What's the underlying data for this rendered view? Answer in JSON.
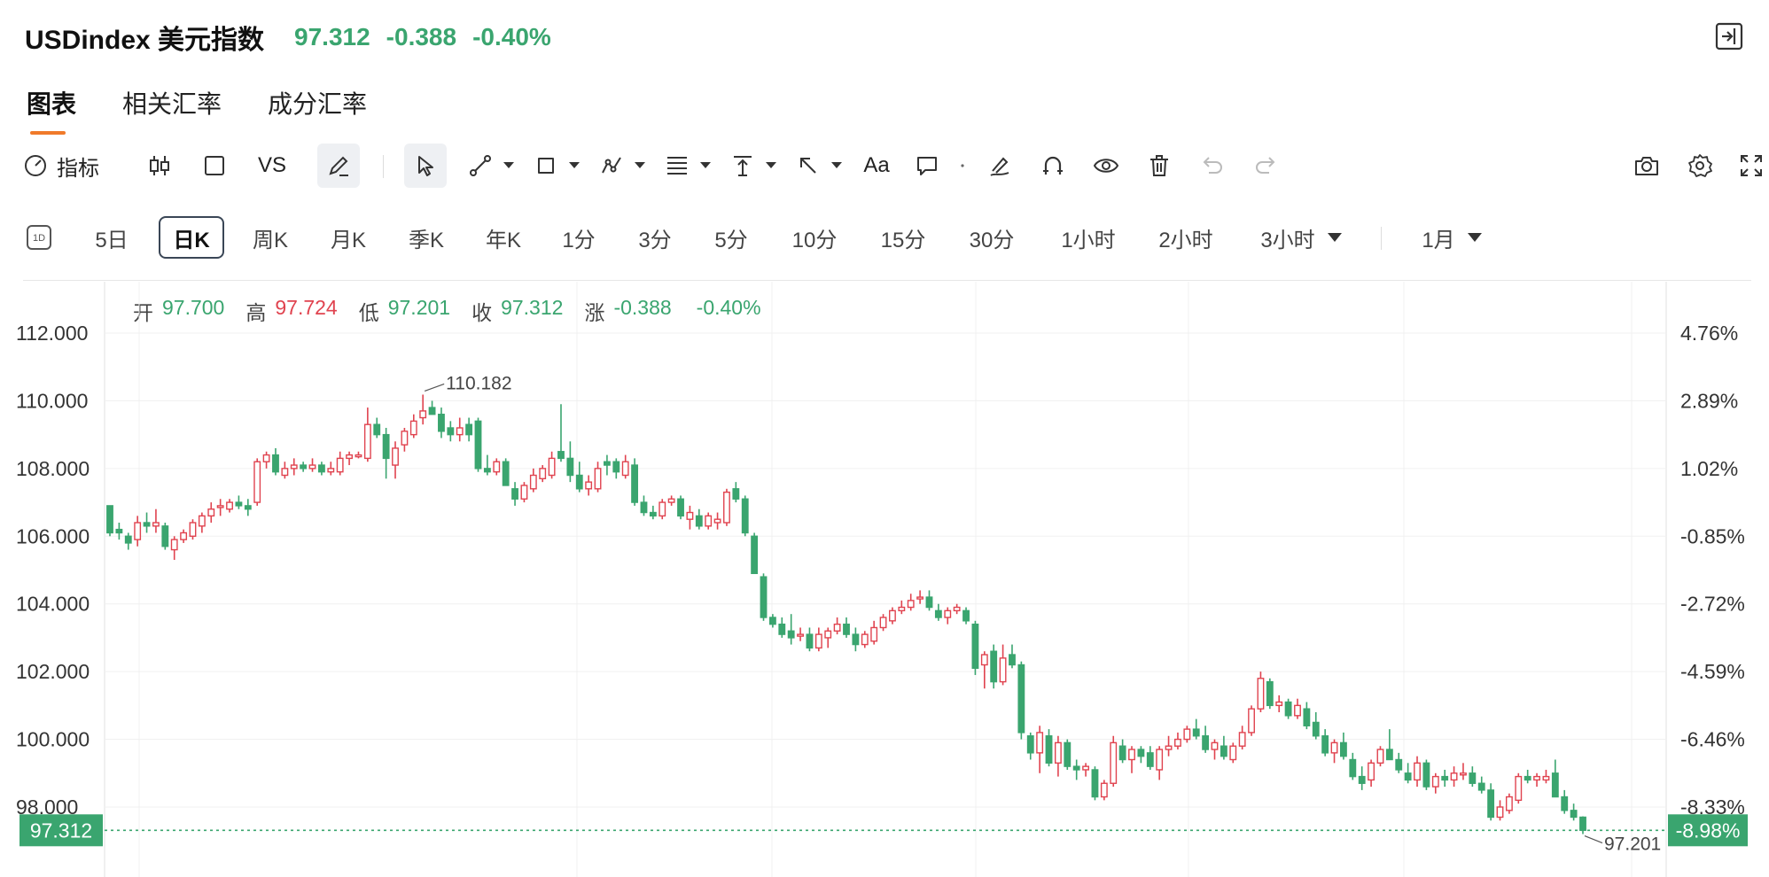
{
  "header": {
    "symbol": "USDindex 美元指数",
    "price": "97.312",
    "change": "-0.388",
    "change_pct": "-0.40%"
  },
  "tabs": [
    "图表",
    "相关汇率",
    "成分汇率"
  ],
  "toolbar": {
    "indicator_label": "指标",
    "vs_label": "VS",
    "text_label": "Aa"
  },
  "periods": [
    "5日",
    "日K",
    "周K",
    "月K",
    "季K",
    "年K",
    "1分",
    "3分",
    "5分",
    "10分",
    "15分",
    "30分",
    "1小时",
    "2小时",
    "3小时",
    "1月"
  ],
  "ohlc": {
    "open_label": "开",
    "open": "97.700",
    "high_label": "高",
    "high": "97.724",
    "low_label": "低",
    "low": "97.201",
    "close_label": "收",
    "close": "97.312",
    "chg_label": "涨",
    "chg": "-0.388",
    "chg_pct": "-0.40%"
  },
  "colors": {
    "up": "#e0434f",
    "down": "#3aa56f",
    "accent": "#f07a2a"
  },
  "chart_data": {
    "type": "candlestick",
    "y_ticks": [
      "112.000",
      "110.000",
      "108.000",
      "106.000",
      "104.000",
      "102.000",
      "100.000",
      "98.000"
    ],
    "y_pct_ticks": [
      "4.76%",
      "2.89%",
      "1.02%",
      "-0.85%",
      "-2.72%",
      "-4.59%",
      "-6.46%",
      "-8.33%"
    ],
    "ylim": [
      97.0,
      112.0
    ],
    "last_price": "97.312",
    "last_pct": "-8.98%",
    "max_label": "110.182",
    "min_label": "97.201",
    "candles": [
      [
        106.9,
        106.9,
        106.0,
        106.1
      ],
      [
        106.2,
        106.4,
        105.9,
        106.1
      ],
      [
        106.0,
        106.1,
        105.6,
        105.8
      ],
      [
        105.9,
        106.6,
        105.7,
        106.4
      ],
      [
        106.4,
        106.7,
        106.1,
        106.3
      ],
      [
        106.3,
        106.8,
        106.1,
        106.4
      ],
      [
        106.3,
        106.4,
        105.6,
        105.7
      ],
      [
        105.6,
        106.0,
        105.3,
        105.9
      ],
      [
        105.9,
        106.2,
        105.8,
        106.1
      ],
      [
        106.0,
        106.5,
        105.9,
        106.4
      ],
      [
        106.3,
        106.7,
        106.1,
        106.6
      ],
      [
        106.6,
        107.0,
        106.4,
        106.8
      ],
      [
        106.9,
        107.1,
        106.6,
        106.9
      ],
      [
        106.8,
        107.1,
        106.7,
        107.0
      ],
      [
        107.0,
        107.2,
        106.8,
        106.9
      ],
      [
        106.9,
        107.1,
        106.6,
        106.8
      ],
      [
        107.0,
        108.3,
        106.9,
        108.2
      ],
      [
        108.2,
        108.5,
        108.0,
        108.4
      ],
      [
        108.4,
        108.6,
        107.8,
        107.9
      ],
      [
        107.8,
        108.2,
        107.7,
        108.0
      ],
      [
        108.0,
        108.3,
        107.8,
        108.1
      ],
      [
        108.1,
        108.2,
        107.9,
        108.0
      ],
      [
        108.0,
        108.3,
        107.9,
        108.1
      ],
      [
        108.1,
        108.2,
        107.8,
        107.9
      ],
      [
        107.9,
        108.2,
        107.8,
        108.0
      ],
      [
        107.9,
        108.5,
        107.8,
        108.3
      ],
      [
        108.3,
        108.5,
        108.1,
        108.4
      ],
      [
        108.4,
        108.5,
        108.3,
        108.4
      ],
      [
        108.3,
        109.8,
        108.2,
        109.3
      ],
      [
        109.3,
        109.5,
        108.9,
        109.0
      ],
      [
        109.0,
        109.2,
        107.7,
        108.3
      ],
      [
        108.1,
        108.8,
        107.7,
        108.6
      ],
      [
        108.7,
        109.2,
        108.5,
        109.1
      ],
      [
        109.0,
        109.6,
        108.9,
        109.4
      ],
      [
        109.5,
        110.182,
        109.3,
        109.7
      ],
      [
        109.8,
        110.0,
        109.6,
        109.6
      ],
      [
        109.6,
        109.8,
        108.9,
        109.1
      ],
      [
        109.2,
        109.4,
        108.8,
        109.0
      ],
      [
        109.0,
        109.5,
        108.8,
        109.2
      ],
      [
        109.3,
        109.5,
        108.8,
        109.0
      ],
      [
        109.4,
        109.5,
        107.9,
        108.0
      ],
      [
        108.0,
        108.4,
        107.8,
        107.9
      ],
      [
        107.9,
        108.3,
        107.8,
        108.2
      ],
      [
        108.2,
        108.3,
        107.5,
        107.5
      ],
      [
        107.4,
        107.6,
        106.9,
        107.1
      ],
      [
        107.1,
        107.6,
        107.0,
        107.5
      ],
      [
        107.4,
        108.0,
        107.3,
        107.8
      ],
      [
        107.7,
        108.1,
        107.6,
        108.0
      ],
      [
        107.8,
        108.5,
        107.7,
        108.3
      ],
      [
        108.5,
        109.9,
        108.2,
        108.3
      ],
      [
        108.3,
        108.8,
        107.6,
        107.8
      ],
      [
        107.8,
        108.2,
        107.3,
        107.4
      ],
      [
        107.4,
        107.8,
        107.2,
        107.6
      ],
      [
        107.4,
        108.2,
        107.3,
        108.0
      ],
      [
        108.2,
        108.4,
        107.8,
        108.1
      ],
      [
        108.2,
        108.3,
        107.7,
        107.9
      ],
      [
        107.8,
        108.4,
        107.7,
        108.2
      ],
      [
        108.1,
        108.3,
        106.9,
        107.0
      ],
      [
        107.0,
        107.2,
        106.6,
        106.7
      ],
      [
        106.7,
        106.9,
        106.5,
        106.6
      ],
      [
        106.6,
        107.1,
        106.5,
        107.0
      ],
      [
        107.0,
        107.2,
        106.9,
        107.1
      ],
      [
        107.1,
        107.2,
        106.5,
        106.6
      ],
      [
        106.5,
        106.9,
        106.2,
        106.7
      ],
      [
        106.6,
        106.8,
        106.2,
        106.3
      ],
      [
        106.3,
        106.7,
        106.2,
        106.6
      ],
      [
        106.4,
        106.7,
        106.2,
        106.5
      ],
      [
        106.4,
        107.4,
        106.3,
        107.3
      ],
      [
        107.4,
        107.6,
        107.0,
        107.1
      ],
      [
        107.1,
        107.2,
        106.0,
        106.1
      ],
      [
        106.0,
        106.1,
        104.9,
        104.9
      ],
      [
        104.8,
        104.9,
        103.5,
        103.6
      ],
      [
        103.6,
        103.7,
        103.3,
        103.4
      ],
      [
        103.4,
        103.6,
        103.0,
        103.1
      ],
      [
        103.2,
        103.7,
        102.8,
        103.0
      ],
      [
        103.1,
        103.3,
        102.9,
        103.1
      ],
      [
        103.1,
        103.3,
        102.6,
        102.7
      ],
      [
        102.7,
        103.3,
        102.6,
        103.1
      ],
      [
        103.0,
        103.3,
        102.7,
        103.2
      ],
      [
        103.2,
        103.6,
        103.1,
        103.4
      ],
      [
        103.4,
        103.6,
        103.0,
        103.1
      ],
      [
        103.1,
        103.3,
        102.6,
        102.8
      ],
      [
        102.8,
        103.2,
        102.7,
        103.1
      ],
      [
        102.9,
        103.5,
        102.8,
        103.3
      ],
      [
        103.3,
        103.7,
        103.2,
        103.6
      ],
      [
        103.5,
        103.9,
        103.4,
        103.8
      ],
      [
        103.8,
        104.1,
        103.7,
        103.9
      ],
      [
        103.9,
        104.3,
        103.8,
        104.1
      ],
      [
        104.2,
        104.4,
        104.0,
        104.2
      ],
      [
        104.2,
        104.4,
        103.8,
        103.9
      ],
      [
        103.8,
        104.0,
        103.5,
        103.6
      ],
      [
        103.6,
        103.9,
        103.4,
        103.8
      ],
      [
        103.8,
        104.0,
        103.7,
        103.9
      ],
      [
        103.8,
        103.9,
        103.4,
        103.5
      ],
      [
        103.4,
        103.5,
        101.9,
        102.1
      ],
      [
        102.2,
        102.6,
        101.5,
        102.5
      ],
      [
        102.6,
        102.8,
        101.5,
        101.7
      ],
      [
        101.7,
        102.8,
        101.6,
        102.4
      ],
      [
        102.5,
        102.8,
        102.1,
        102.2
      ],
      [
        102.2,
        102.3,
        100.0,
        100.2
      ],
      [
        100.1,
        100.2,
        99.4,
        99.6
      ],
      [
        99.6,
        100.4,
        99.0,
        100.2
      ],
      [
        100.1,
        100.3,
        99.2,
        99.3
      ],
      [
        99.3,
        100.1,
        98.9,
        99.9
      ],
      [
        99.9,
        100.0,
        99.1,
        99.2
      ],
      [
        99.2,
        99.4,
        98.8,
        99.1
      ],
      [
        99.1,
        99.3,
        98.9,
        99.2
      ],
      [
        99.1,
        99.2,
        98.2,
        98.3
      ],
      [
        98.3,
        98.8,
        98.2,
        98.7
      ],
      [
        98.7,
        100.1,
        98.6,
        99.9
      ],
      [
        99.8,
        100.0,
        99.3,
        99.4
      ],
      [
        99.4,
        99.8,
        99.0,
        99.7
      ],
      [
        99.7,
        99.8,
        99.3,
        99.5
      ],
      [
        99.6,
        99.8,
        99.1,
        99.2
      ],
      [
        99.1,
        99.8,
        98.8,
        99.7
      ],
      [
        99.7,
        100.1,
        99.5,
        99.8
      ],
      [
        99.8,
        100.2,
        99.7,
        100.0
      ],
      [
        100.0,
        100.4,
        99.9,
        100.3
      ],
      [
        100.3,
        100.6,
        100.0,
        100.1
      ],
      [
        100.1,
        100.4,
        99.6,
        99.7
      ],
      [
        99.7,
        100.0,
        99.4,
        99.9
      ],
      [
        99.8,
        100.1,
        99.4,
        99.5
      ],
      [
        99.4,
        99.9,
        99.3,
        99.8
      ],
      [
        99.8,
        100.4,
        99.7,
        100.2
      ],
      [
        100.2,
        101.0,
        100.1,
        100.9
      ],
      [
        100.9,
        102.0,
        100.8,
        101.8
      ],
      [
        101.7,
        101.8,
        100.9,
        101.0
      ],
      [
        101.0,
        101.3,
        100.8,
        101.1
      ],
      [
        101.1,
        101.2,
        100.6,
        100.7
      ],
      [
        100.7,
        101.2,
        100.6,
        101.0
      ],
      [
        100.9,
        101.1,
        100.3,
        100.4
      ],
      [
        100.5,
        100.8,
        100.0,
        100.1
      ],
      [
        100.1,
        100.3,
        99.5,
        99.6
      ],
      [
        99.6,
        100.0,
        99.3,
        99.9
      ],
      [
        99.9,
        100.2,
        99.4,
        99.5
      ],
      [
        99.4,
        99.6,
        98.8,
        98.9
      ],
      [
        98.9,
        99.2,
        98.5,
        98.7
      ],
      [
        98.8,
        99.4,
        98.6,
        99.3
      ],
      [
        99.3,
        99.8,
        99.2,
        99.7
      ],
      [
        99.7,
        100.3,
        99.5,
        99.4
      ],
      [
        99.4,
        99.6,
        99.0,
        99.1
      ],
      [
        99.0,
        99.3,
        98.7,
        98.8
      ],
      [
        98.8,
        99.5,
        98.6,
        99.3
      ],
      [
        99.3,
        99.4,
        98.5,
        98.6
      ],
      [
        98.6,
        99.0,
        98.4,
        98.9
      ],
      [
        98.9,
        99.1,
        98.6,
        98.8
      ],
      [
        98.8,
        99.2,
        98.6,
        99.0
      ],
      [
        99.0,
        99.3,
        98.8,
        99.0
      ],
      [
        99.0,
        99.2,
        98.6,
        98.7
      ],
      [
        98.7,
        98.9,
        98.4,
        98.5
      ],
      [
        98.5,
        98.7,
        97.6,
        97.7
      ],
      [
        97.7,
        98.2,
        97.6,
        98.0
      ],
      [
        97.9,
        98.4,
        97.8,
        98.3
      ],
      [
        98.2,
        99.0,
        98.1,
        98.9
      ],
      [
        98.9,
        99.1,
        98.7,
        98.8
      ],
      [
        98.8,
        99.0,
        98.6,
        98.9
      ],
      [
        98.8,
        99.1,
        98.7,
        98.9
      ],
      [
        99.0,
        99.4,
        98.4,
        98.3
      ],
      [
        98.3,
        98.5,
        97.8,
        97.9
      ],
      [
        97.9,
        98.1,
        97.6,
        97.7
      ],
      [
        97.7,
        97.724,
        97.201,
        97.312
      ]
    ]
  }
}
